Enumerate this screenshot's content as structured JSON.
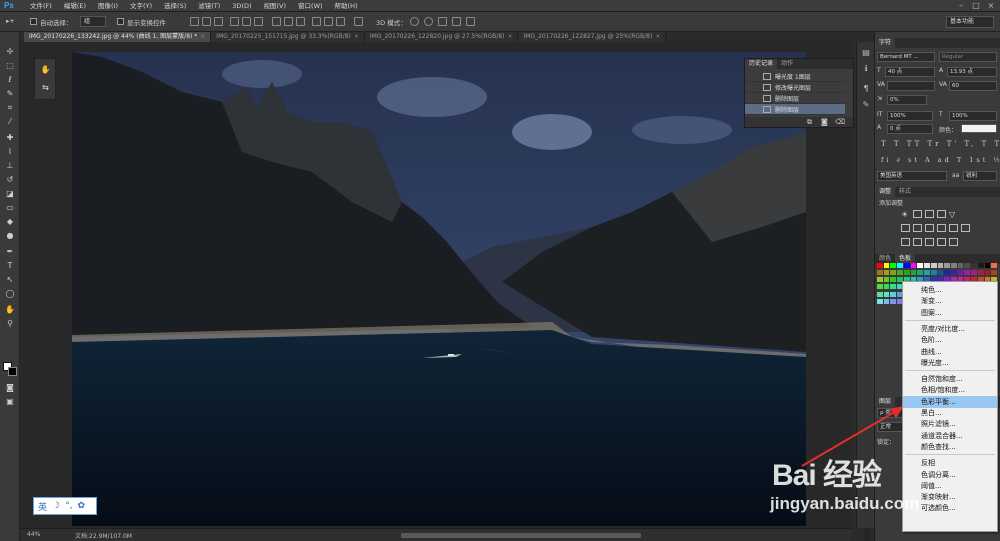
{
  "app": {
    "logo": "Ps",
    "menu": [
      "文件(F)",
      "编辑(E)",
      "图像(I)",
      "文字(Y)",
      "选择(S)",
      "滤镜(T)",
      "3D(D)",
      "视图(V)",
      "窗口(W)",
      "帮助(H)"
    ]
  },
  "options_bar": {
    "auto_select_label": "自动选择：",
    "auto_select_value": "组",
    "show_transform_label": "显示变换控件",
    "mode_3d_label": "3D 模式：",
    "workspace": "基本功能"
  },
  "tabs": [
    {
      "label": "IMG_20170226_133242.jpg @ 44% (曲线 1, 图层蒙版/8) *",
      "active": true
    },
    {
      "label": "IMG_20170225_151715.jpg @ 33.3%(RGB/8)",
      "active": false
    },
    {
      "label": "IMG_20170226_122820.jpg @ 27.5%(RGB/8)",
      "active": false
    },
    {
      "label": "IMG_20170226_122827.jpg @ 25%(RGB/8)",
      "active": false
    }
  ],
  "status": {
    "zoom": "44%",
    "doc_size": "文档:22.9M/107.0M"
  },
  "ime": [
    "英",
    "☽",
    "°,",
    "✿"
  ],
  "history_panel": {
    "tabs": [
      "历史记录",
      "动作"
    ],
    "items": [
      {
        "label": "曝光度 1图层",
        "active": false
      },
      {
        "label": "修改曝光图层",
        "active": false
      },
      {
        "label": "删除图层",
        "active": false
      },
      {
        "label": "删除图层",
        "active": true
      }
    ]
  },
  "character_panel": {
    "tab": "字符",
    "font_family": "Bernard MT ...",
    "font_style": "Regular",
    "font_size": "40 点",
    "leading": "13.93 点",
    "tracking": "60",
    "kerning": "0%",
    "vscale": "100%",
    "hscale": "100%",
    "baseline": "0 点",
    "color_label": "颜色：",
    "glyph_row1": "T T TT Tr T' T, T T",
    "glyph_row2": "fi ∂ st A ad T 1st ½",
    "language": "美国英语",
    "aa_prefix": "aa",
    "antialias": "锐利"
  },
  "adjustments_panel": {
    "tabs": [
      "调整",
      "样式"
    ],
    "title": "添加调整"
  },
  "swatches_panel": {
    "tabs": [
      "颜色",
      "色板"
    ]
  },
  "layers_panel": {
    "tab": "图层",
    "filter_prefix": "ρ 类",
    "mode_prefix": "正常",
    "lock_prefix": "锁定："
  },
  "context_menu": {
    "items": [
      {
        "label": "纯色...",
        "highlight": false
      },
      {
        "label": "渐变...",
        "highlight": false
      },
      {
        "label": "图案...",
        "highlight": false
      },
      {
        "sep": true
      },
      {
        "label": "亮度/对比度...",
        "highlight": false
      },
      {
        "label": "色阶...",
        "highlight": false
      },
      {
        "label": "曲线...",
        "highlight": false
      },
      {
        "label": "曝光度...",
        "highlight": false
      },
      {
        "sep": true
      },
      {
        "label": "自然饱和度...",
        "highlight": false
      },
      {
        "label": "色相/饱和度...",
        "highlight": false
      },
      {
        "label": "色彩平衡...",
        "highlight": true
      },
      {
        "label": "黑白...",
        "highlight": false
      },
      {
        "label": "照片滤镜...",
        "highlight": false
      },
      {
        "label": "通道混合器...",
        "highlight": false
      },
      {
        "label": "颜色查找...",
        "highlight": false
      },
      {
        "sep": true
      },
      {
        "label": "反相",
        "highlight": false
      },
      {
        "label": "色调分离...",
        "highlight": false
      },
      {
        "label": "阈值...",
        "highlight": false
      },
      {
        "label": "渐变映射...",
        "highlight": false
      },
      {
        "label": "可选颜色...",
        "highlight": false
      }
    ]
  },
  "watermark": {
    "brand": "Bai 经验",
    "url": "jingyan.baidu.com"
  },
  "colors": {
    "accent_highlight": "#9ac6f2",
    "history_active": "#5d6d86",
    "arrow": "#e0302a"
  }
}
